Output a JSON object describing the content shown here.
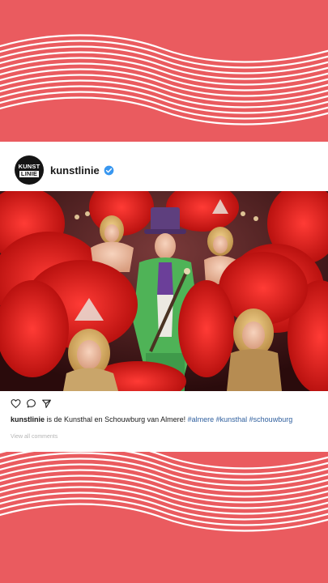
{
  "post": {
    "account": {
      "logo_line1": "KUNST",
      "logo_line2": "LINIE",
      "username": "kunstlinie",
      "verified_icon": "verified-badge-icon"
    },
    "photo": {
      "description": "performers in red feathered costumes with a host in a green suit and purple top hat"
    },
    "actions": {
      "icons": [
        "heart-icon",
        "comment-icon",
        "share-icon"
      ]
    },
    "caption": {
      "username": "kunstlinie",
      "text": " is de Kunsthal en Schouwburg van Almere! ",
      "hashtags": "#almere #kunsthal #schouwburg"
    },
    "view_comments": "View all comments"
  },
  "colors": {
    "background": "#ea5b5f",
    "panel": "#ffffff",
    "hashtag": "#2f5f9e",
    "verified": "#3897f0"
  }
}
